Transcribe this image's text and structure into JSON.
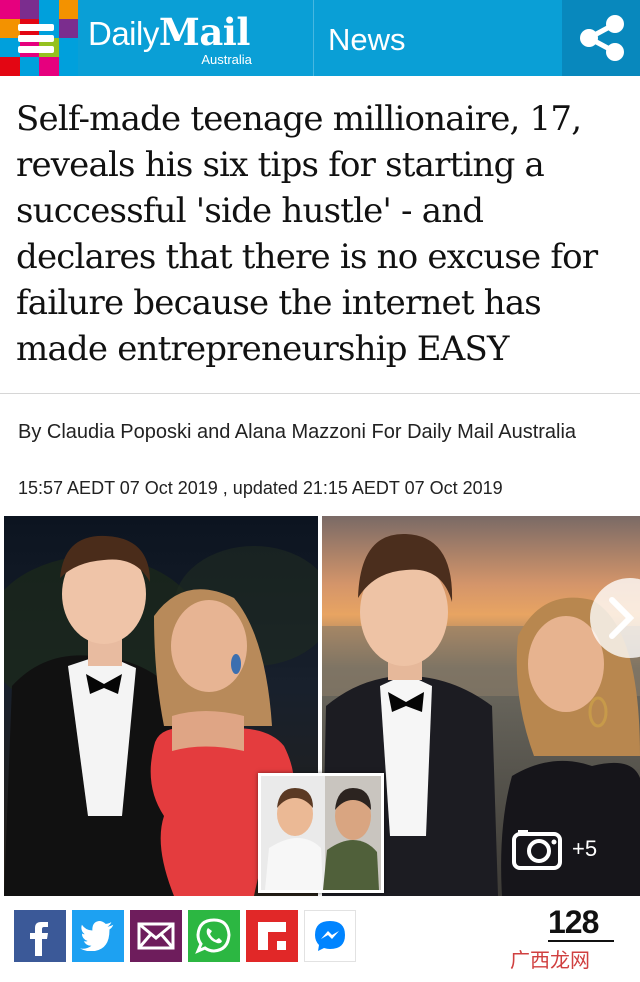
{
  "header": {
    "menu_icon": "hamburger-icon",
    "logo_word_1": "Daily",
    "logo_word_2": "Mail",
    "logo_edition": "Australia",
    "section": "News",
    "share_icon": "share-icon",
    "brand_color": "#0a9fd6",
    "share_box_color": "#0888bd"
  },
  "article": {
    "headline": "Self-made teenage millionaire, 17, reveals his six tips for starting a successful 'side hustle' - and declares that there is no excuse for failure because the internet has made entrepreneurship EASY",
    "byline": "By Claudia Poposki and Alana Mazzoni For Daily Mail Australia",
    "dateline": "15:57 AEDT 07 Oct 2019 , updated 21:15 AEDT 07 Oct 2019"
  },
  "media": {
    "left_photo": "teen in tuxedo with girl in red dress at night",
    "right_photo": "teen in tuxedo with girl at sunset",
    "inset_photo": "teen with older man",
    "next_icon": "chevron-right-icon",
    "gallery_icon": "camera-icon",
    "gallery_count": "+5"
  },
  "share_bar": {
    "buttons": [
      {
        "name": "facebook",
        "icon": "facebook-icon",
        "color": "#3b5998"
      },
      {
        "name": "twitter",
        "icon": "twitter-icon",
        "color": "#1da1f2"
      },
      {
        "name": "email",
        "icon": "email-icon",
        "color": "#6e1d5c"
      },
      {
        "name": "whatsapp",
        "icon": "whatsapp-icon",
        "color": "#2cb742"
      },
      {
        "name": "flipboard",
        "icon": "flipboard-icon",
        "color": "#e12828"
      },
      {
        "name": "messenger",
        "icon": "messenger-icon",
        "color": "#0084ff"
      }
    ],
    "comment_count": "128"
  },
  "watermark": "广西龙网"
}
